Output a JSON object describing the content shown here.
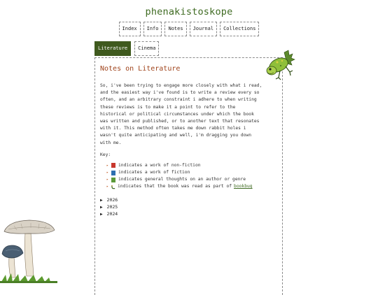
{
  "site": {
    "title": "phenakistoskope"
  },
  "topnav": [
    "Index",
    "Info",
    "Notes",
    "Journal",
    "Collections"
  ],
  "subnav": [
    {
      "label": "Literature",
      "active": true
    },
    {
      "label": "Cinema",
      "active": false
    }
  ],
  "page": {
    "title": "Notes on Literature",
    "intro_lines": [
      "So, i've been trying to engage more closely with what i read,",
      "and the easiest way i've found is to write a review every so",
      "often, and an arbitrary constraint i adhere to when writing",
      "these reviews is to make it a point to refer to the",
      "historical or political circumstances under which the book",
      "was written and published, or to another text that resonates",
      "with it. This method often takes me down rabbit holes i",
      "wasn't quite anticipating and well, i'm dragging you down",
      "with me."
    ],
    "key_label": "Key:",
    "key_items": [
      {
        "icon": "red-book-icon",
        "color": "#c8372d",
        "text": "indicates a work of non-fiction"
      },
      {
        "icon": "blue-book-icon",
        "color": "#2e6fb0",
        "text": "indicates a work of fiction"
      },
      {
        "icon": "green-book-icon",
        "color": "#5c9a3a",
        "text": "indicates general thoughts on an author or genre"
      },
      {
        "icon": "bookworm-icon",
        "color": "#3f6b22",
        "text": "indicates that the book was read as part of",
        "link": "bookbug"
      }
    ],
    "years": [
      "2026",
      "2025",
      "2024"
    ]
  },
  "colors": {
    "accent": "#3f5a1e",
    "title_red": "#a0441c"
  }
}
